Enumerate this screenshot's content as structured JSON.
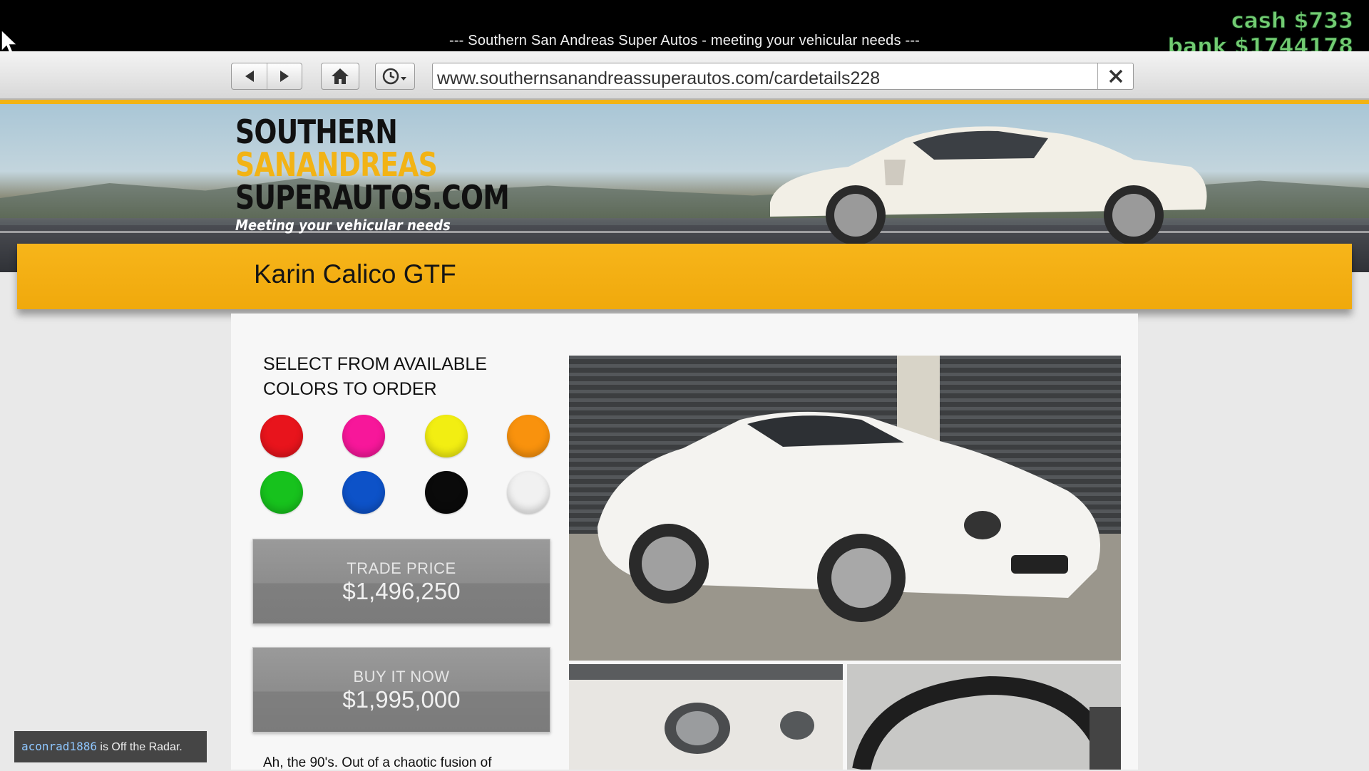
{
  "window": {
    "title": "--- Southern San Andreas Super Autos - meeting your vehicular needs ---"
  },
  "hud": {
    "cash": "cash $733",
    "bank": "bank $1744178",
    "color": "#72cc72"
  },
  "browser": {
    "url": "www.southernsanandreassuperautos.com/cardetails228",
    "buttons": [
      "back-icon",
      "forward-icon",
      "home-icon",
      "history-icon",
      "close-icon"
    ]
  },
  "banner": {
    "logo_line1": "SOUTHERN",
    "logo_line2": "SANANDREAS",
    "logo_line3": "SUPERAUTOS.COM",
    "tagline": "Meeting your vehicular needs",
    "accent": "#f2b315"
  },
  "car": {
    "name": "Karin Calico GTF"
  },
  "colors": {
    "heading": "SELECT FROM AVAILABLE COLORS TO ORDER",
    "swatches": [
      {
        "name": "red",
        "hex": "#e8141c"
      },
      {
        "name": "pink",
        "hex": "#f7179a"
      },
      {
        "name": "yellow",
        "hex": "#f2ee12"
      },
      {
        "name": "orange",
        "hex": "#f9920d"
      },
      {
        "name": "green",
        "hex": "#17c21d"
      },
      {
        "name": "blue",
        "hex": "#0d52c8"
      },
      {
        "name": "black",
        "hex": "#0a0a0a"
      },
      {
        "name": "white",
        "hex": "#f1f1f1"
      }
    ]
  },
  "pricing": {
    "trade_label": "TRADE PRICE",
    "trade_value": "$1,496,250",
    "buy_label": "BUY IT NOW",
    "buy_value": "$1,995,000"
  },
  "description": "Ah, the 90's. Out of a chaotic fusion of",
  "notification": {
    "user": "aconrad1886",
    "message": " is Off the Radar."
  }
}
